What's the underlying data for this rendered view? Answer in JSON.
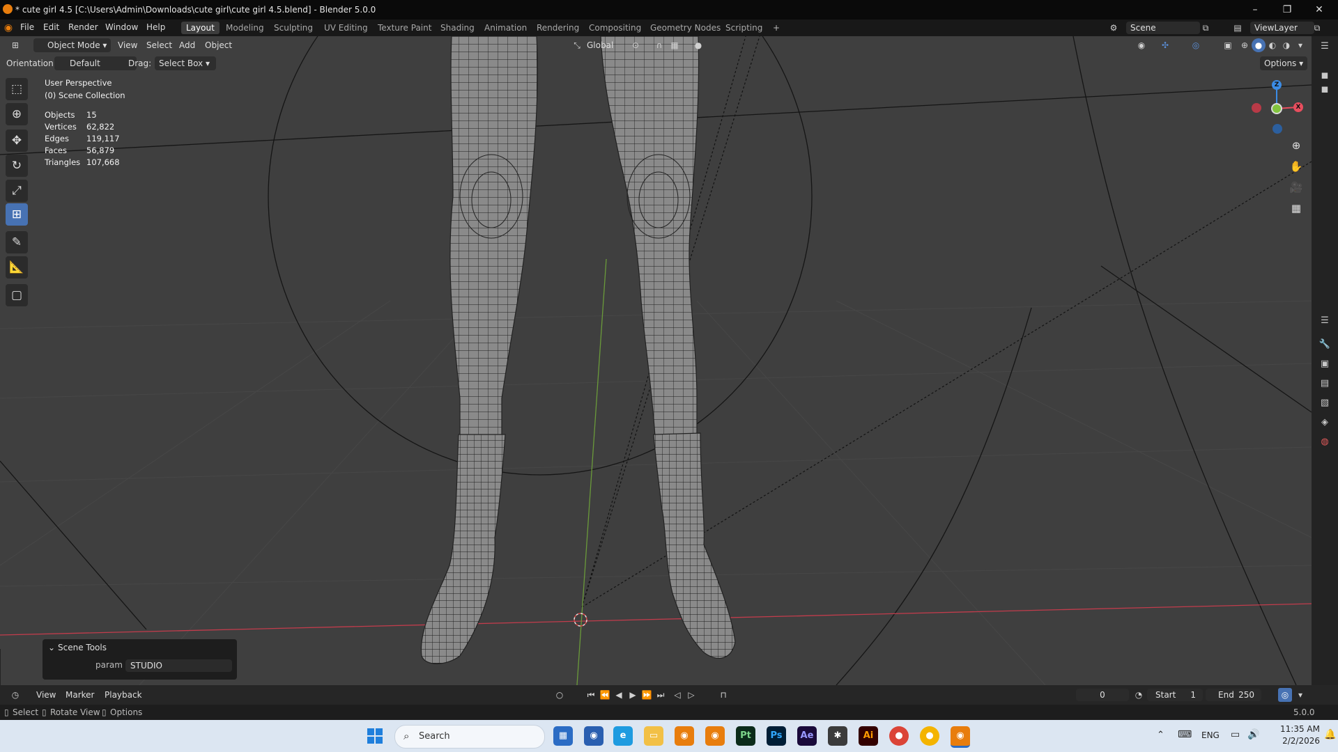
{
  "window": {
    "title": "* cute girl 4.5 [C:\\Users\\Admin\\Downloads\\cute girl\\cute girl 4.5.blend] - Blender 5.0.0",
    "minimize": "–",
    "maximize": "❐",
    "close": "✕"
  },
  "menus": [
    "File",
    "Edit",
    "Render",
    "Window",
    "Help"
  ],
  "workspaces": [
    "Layout",
    "Modeling",
    "Sculpting",
    "UV Editing",
    "Texture Paint",
    "Shading",
    "Animation",
    "Rendering",
    "Compositing",
    "Geometry Nodes",
    "Scripting"
  ],
  "workspace_add": "+",
  "active_workspace": "Layout",
  "scene": {
    "label": "Scene",
    "view_layer": "ViewLayer"
  },
  "viewport_header": {
    "mode": "Object Mode",
    "menus": [
      "View",
      "Select",
      "Add",
      "Object"
    ],
    "transform_orientation": "Global"
  },
  "tool_settings": {
    "orientation_label": "Orientation:",
    "orientation_value": "Default",
    "drag_label": "Drag:",
    "drag_value": "Select Box",
    "options_label": "Options"
  },
  "overlay": {
    "view_name": "User Perspective",
    "collection": "(0) Scene Collection",
    "stats": [
      {
        "label": "Objects",
        "value": "15"
      },
      {
        "label": "Vertices",
        "value": "62,822"
      },
      {
        "label": "Edges",
        "value": "119,117"
      },
      {
        "label": "Faces",
        "value": "56,879"
      },
      {
        "label": "Triangles",
        "value": "107,668"
      }
    ]
  },
  "gizmo": {
    "z": "Z",
    "x": "X"
  },
  "scene_tools": {
    "title": "Scene Tools",
    "param_label": "param",
    "param_value": "STUDIO"
  },
  "timeline": {
    "menus": [
      "View",
      "Marker",
      "Playback"
    ],
    "current_frame": "0",
    "start_label": "Start",
    "start_value": "1",
    "end_label": "End",
    "end_value": "250"
  },
  "statusbar": {
    "select": "Select",
    "rotate": "Rotate View",
    "options": "Options",
    "version": "5.0.0"
  },
  "taskbar": {
    "search_placeholder": "Search",
    "apps": [
      "Pt",
      "Ps",
      "Ae",
      "Ai"
    ],
    "lang": "ENG",
    "time": "11:35 AM",
    "date": "2/2/2026"
  },
  "colors": {
    "accent": "#4772b3",
    "viewport_bg": "#3f3f3f",
    "x_axis": "#e84e5e",
    "y_axis": "#82c43e",
    "z_axis": "#3b8ce6"
  }
}
